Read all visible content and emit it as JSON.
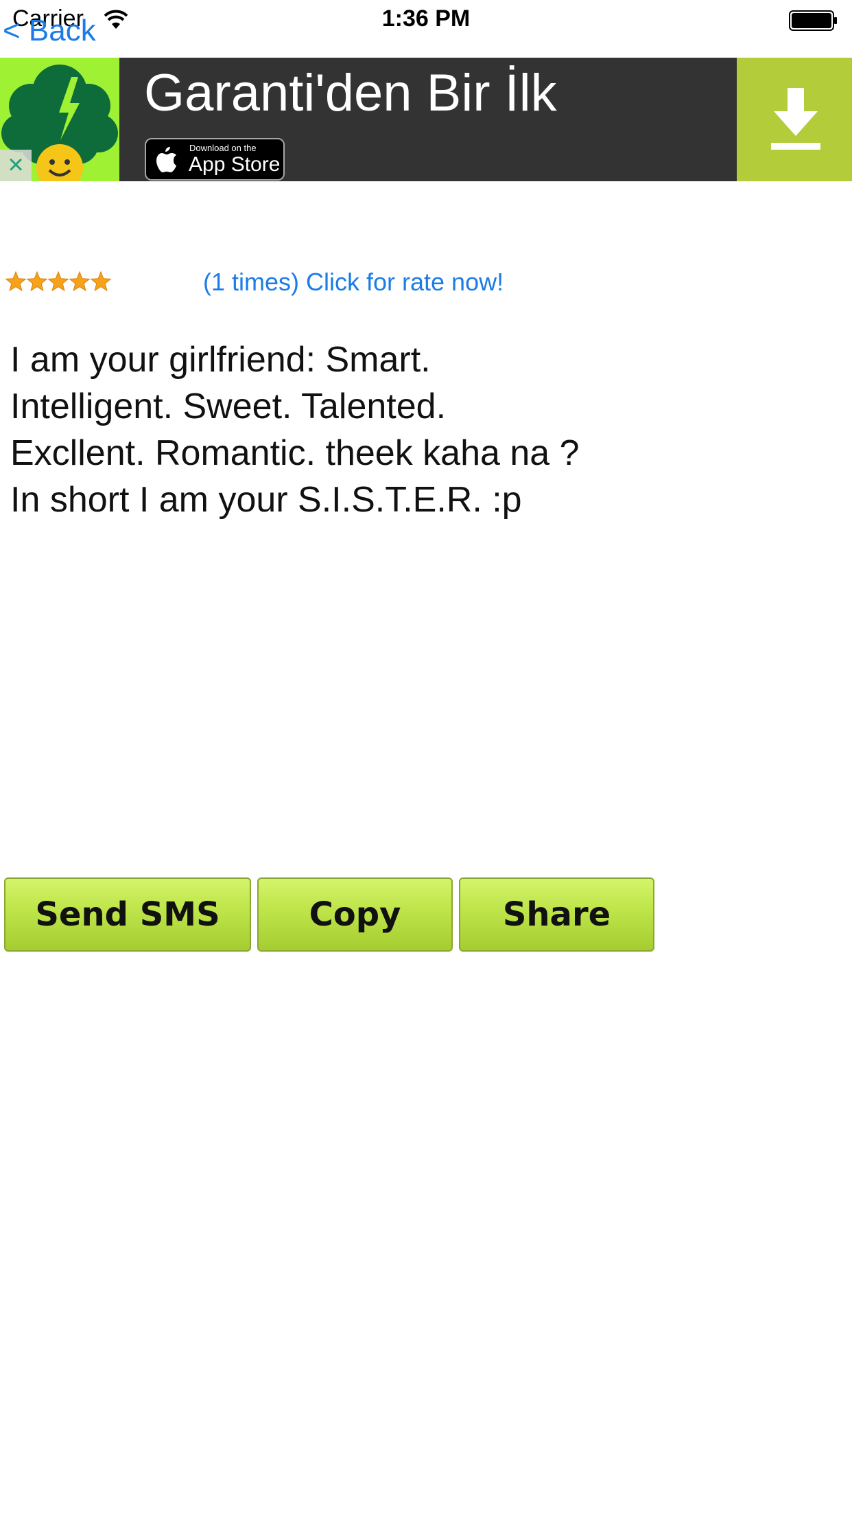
{
  "status_bar": {
    "carrier": "Carrier",
    "time": "1:36 PM"
  },
  "nav": {
    "back_label": "< Back"
  },
  "ad": {
    "headline": "Garanti'den Bir İlk",
    "badge_small": "Download on the",
    "badge_big": "App Store",
    "close_label": "×",
    "colors": {
      "banner": "#333333",
      "icon_bg": "#9ef233",
      "download_bg": "#b2cc3a"
    }
  },
  "rating": {
    "stars": 5,
    "link_text": "(1 times) Click for rate now!"
  },
  "message": {
    "text": "I am your girlfriend: Smart.\nIntelligent. Sweet. Talented.\nExcllent. Romantic. theek kaha na ?\nIn short I am your S.I.S.T.E.R. :p"
  },
  "actions": {
    "send_sms": "Send SMS",
    "copy": "Copy",
    "share": "Share"
  },
  "colors": {
    "link": "#1a7ce6",
    "button_top": "#d4f46a",
    "button_bottom": "#a5cc30"
  }
}
